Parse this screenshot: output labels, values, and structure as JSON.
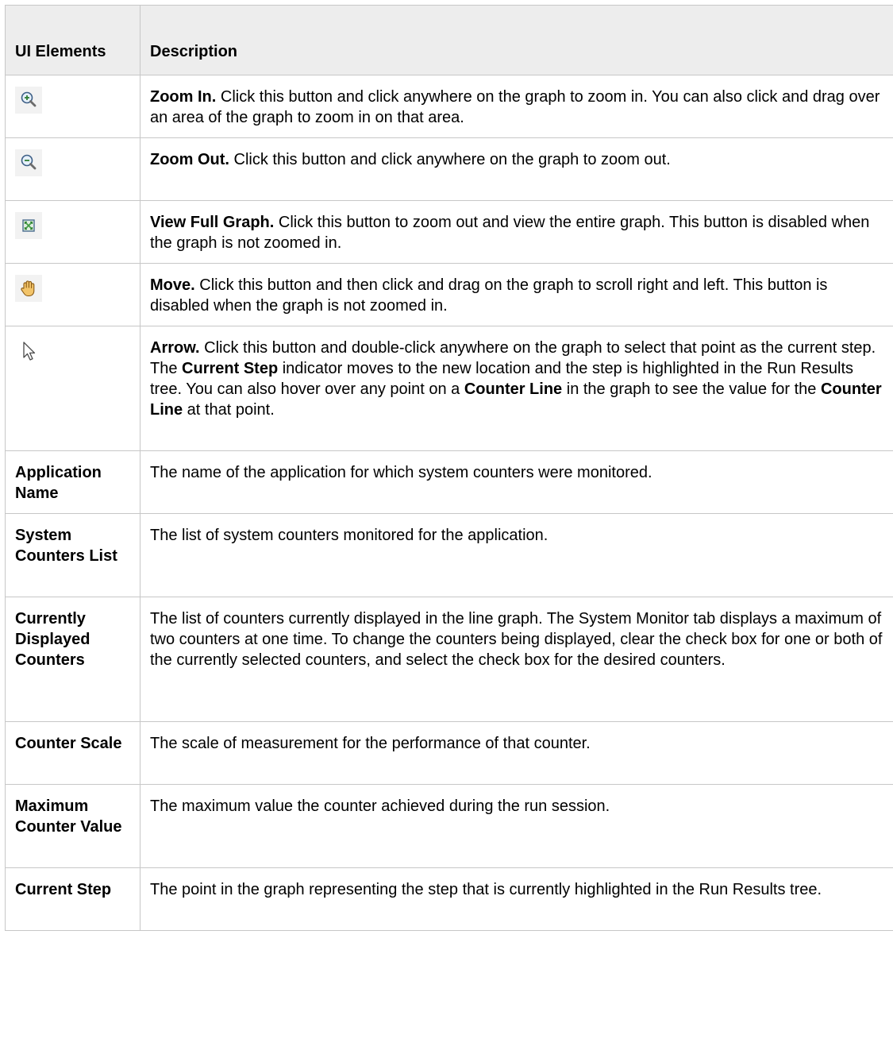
{
  "table": {
    "header": {
      "col1": "UI Elements",
      "col2": "Description"
    },
    "rows": [
      {
        "icon": "zoom-in-icon",
        "title": "Zoom In.",
        "text": " Click this button and click anywhere on the graph to zoom in. You can also click and drag over an area of the graph to zoom in on that area."
      },
      {
        "icon": "zoom-out-icon",
        "title": "Zoom Out.",
        "text": " Click this button and click anywhere on the graph to zoom out."
      },
      {
        "icon": "full-graph-icon",
        "title": "View Full Graph.",
        "text": " Click this button to zoom out and view the entire graph. This button is disabled when the graph is not zoomed in."
      },
      {
        "icon": "hand-move-icon",
        "title": "Move.",
        "text": " Click this button and then click and drag on the graph to scroll right and left. This button is disabled when the graph is not zoomed in."
      },
      {
        "icon": "arrow-pointer-icon",
        "title": "Arrow.",
        "parts": [
          " Click this button and double-click anywhere on the graph to select that point as the current step. The ",
          "Current Step",
          " indicator moves to the new location and the step is highlighted in the Run Results tree. You can also hover over any point on a ",
          "Counter Line",
          " in the graph to see the value for the ",
          "Counter Line",
          " at that point."
        ]
      },
      {
        "element": "Application Name",
        "text": "The name of the application for which system counters were monitored."
      },
      {
        "element": "System Counters List",
        "text": "The list of system counters monitored for the application."
      },
      {
        "element": "Currently Displayed Counters",
        "text": "The list of counters currently displayed in the line graph. The System Monitor tab displays a maximum of two counters at one time. To change the counters being displayed, clear the check box for one or both of the currently selected counters, and select the check box for the desired counters."
      },
      {
        "element": "Counter Scale",
        "text": "The scale of measurement for the performance of that counter."
      },
      {
        "element": "Maximum Counter Value",
        "text": "The maximum value the counter achieved during the run session."
      },
      {
        "element": "Current Step",
        "text": "The point in the graph representing the step that is currently highlighted in the Run Results tree."
      }
    ]
  }
}
